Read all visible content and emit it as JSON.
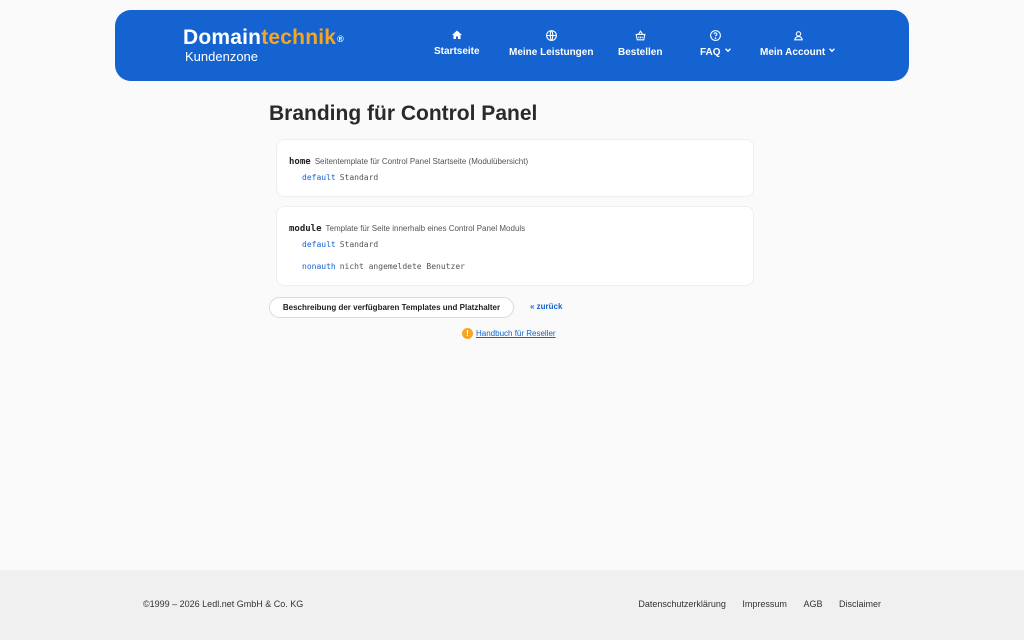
{
  "header": {
    "logo_part1": "Domain",
    "logo_part2": "technik",
    "logo_reg": "®",
    "logo_sub": "Kundenzone",
    "nav": [
      {
        "label": "Startseite",
        "icon": "home-icon"
      },
      {
        "label": "Meine Leistungen",
        "icon": "globe-icon"
      },
      {
        "label": "Bestellen",
        "icon": "basket-icon"
      },
      {
        "label": "FAQ",
        "icon": "question-circle-icon",
        "dropdown": true
      },
      {
        "label": "Mein Account",
        "icon": "user-icon",
        "dropdown": true
      }
    ]
  },
  "main": {
    "title": "Branding für Control Panel",
    "cards": [
      {
        "key": "home",
        "description": "Seitentemplate für Control Panel Startseite (Modulübersicht)",
        "options": [
          {
            "key": "default",
            "value": "Standard"
          }
        ]
      },
      {
        "key": "module",
        "description": "Template für Seite innerhalb eines Control Panel Moduls",
        "options": [
          {
            "key": "default",
            "value": "Standard"
          },
          {
            "key": "nonauth",
            "value": "nicht angemeldete Benutzer"
          }
        ]
      }
    ],
    "description_button": "Beschreibung der verfügbaren Templates und Platzhalter",
    "back_link": "« zurück",
    "manual_icon": "!",
    "manual_link": "Handbuch für Reseller"
  },
  "footer": {
    "copyright": "©1999 – 2026 Ledl.net GmbH & Co. KG",
    "links": [
      "Datenschutzerklärung",
      "Impressum",
      "AGB",
      "Disclaimer"
    ]
  },
  "colors": {
    "brand_blue": "#1463d0",
    "accent_orange": "#f5a623"
  }
}
